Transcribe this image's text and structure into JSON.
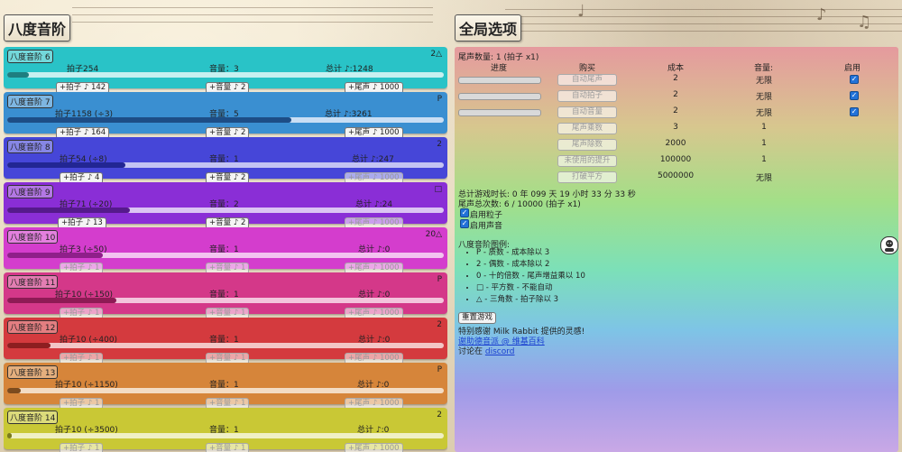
{
  "left_title": "八度音阶",
  "right_title": "全局选项",
  "panels": [
    {
      "tag": "八度音阶 6",
      "mark": "2△",
      "beats": "拍子254",
      "vol": "音量：3",
      "total": "总计 ♪:1248",
      "b1": "+拍子 ♪ 142",
      "b2": "+音量 ♪ 2",
      "b3": "+尾声 ♪ 1000",
      "progress": 0.05
    },
    {
      "tag": "八度音阶 7",
      "mark": "P",
      "beats": "拍子1158 (÷3)",
      "vol": "音量：5",
      "total": "总计 ♪:3261",
      "b1": "+拍子 ♪ 164",
      "b2": "+音量 ♪ 2",
      "b3": "+尾声 ♪ 1000",
      "progress": 0.65
    },
    {
      "tag": "八度音阶 8",
      "mark": "2",
      "beats": "拍子54 (÷8)",
      "vol": "音量：1",
      "total": "总计 ♪:247",
      "b1": "+拍子 ♪ 4",
      "b2": "+音量 ♪ 2",
      "b3": "+尾声 ♪ 1000",
      "progress": 0.27
    },
    {
      "tag": "八度音阶 9",
      "mark": "□",
      "beats": "拍子71 (÷20)",
      "vol": "音量：2",
      "total": "总计 ♪:24",
      "b1": "+拍子 ♪ 13",
      "b2": "+音量 ♪ 2",
      "b3": "+尾声 ♪ 1000",
      "progress": 0.28
    },
    {
      "tag": "八度音阶 10",
      "mark": "20△",
      "beats": "拍子3 (÷50)",
      "vol": "音量：1",
      "total": "总计 ♪:0",
      "b1": "+拍子 ♪ 1",
      "b2": "+音量 ♪ 1",
      "b3": "+尾声 ♪ 1000",
      "progress": 0.22
    },
    {
      "tag": "八度音阶 11",
      "mark": "P",
      "beats": "拍子10 (÷150)",
      "vol": "音量：1",
      "total": "总计 ♪:0",
      "b1": "+拍子 ♪ 1",
      "b2": "+音量 ♪ 1",
      "b3": "+尾声 ♪ 1000",
      "progress": 0.25
    },
    {
      "tag": "八度音阶 12",
      "mark": "2",
      "beats": "拍子10 (÷400)",
      "vol": "音量：1",
      "total": "总计 ♪:0",
      "b1": "+拍子 ♪ 1",
      "b2": "+音量 ♪ 1",
      "b3": "+尾声 ♪ 1000",
      "progress": 0.1
    },
    {
      "tag": "八度音阶 13",
      "mark": "P",
      "beats": "拍子10 (÷1150)",
      "vol": "音量：1",
      "total": "总计 ♪:0",
      "b1": "+拍子 ♪ 1",
      "b2": "+音量 ♪ 1",
      "b3": "+尾声 ♪ 1000",
      "progress": 0.03
    },
    {
      "tag": "八度音阶 14",
      "mark": "2",
      "beats": "拍子10 (÷3500)",
      "vol": "音量：1",
      "total": "总计 ♪:0",
      "b1": "+拍子 ♪ 1",
      "b2": "+音量 ♪ 1",
      "b3": "+尾声 ♪ 1000",
      "progress": 0.01
    }
  ],
  "colors": {
    "panel_bg": [
      "#29c3c7",
      "#3a8fd1",
      "#4646d8",
      "#8a2ed6",
      "#d43dcd",
      "#d43889",
      "#d43a3e",
      "#d6853a",
      "#c9c835"
    ],
    "panel_fill": [
      "#1e7e80",
      "#1d4d86",
      "#222693",
      "#551a8c",
      "#8f1f8a",
      "#8e1b55",
      "#8d1e20",
      "#7c4b1e",
      "#7a7a1c"
    ],
    "panel_track": [
      "#c8f0f0",
      "#c9def4",
      "#c4c4f3",
      "#dbc4f3",
      "#f3c4f0",
      "#f3c4dc",
      "#f3c6c6",
      "#f3dcc4",
      "#f0f0c4"
    ]
  },
  "right": {
    "echo_count": "尾声数量:  1  (拍子 x1)",
    "headers": [
      "进度",
      "购买",
      "成本",
      "音量:",
      "启用"
    ],
    "rows": [
      {
        "label": "自动尾声",
        "cost": "2",
        "vol": "无限",
        "checked": true,
        "has_progress": true
      },
      {
        "label": "自动拍子",
        "cost": "2",
        "vol": "无限",
        "checked": true,
        "has_progress": true
      },
      {
        "label": "自动音量",
        "cost": "2",
        "vol": "无限",
        "checked": true,
        "has_progress": true
      },
      {
        "label": "尾声乘数",
        "cost": "3",
        "vol": "1",
        "checked": false,
        "has_progress": false
      },
      {
        "label": "尾声除数",
        "cost": "2000",
        "vol": "1",
        "checked": false,
        "has_progress": false
      },
      {
        "label": "未使用的提升",
        "cost": "100000",
        "vol": "1",
        "checked": false,
        "has_progress": false
      },
      {
        "label": "打破平方",
        "cost": "5000000",
        "vol": "无限",
        "checked": false,
        "has_progress": false
      }
    ],
    "total_time": "总计游戏时长:   0 年 099 天 19 小时 33 分 33 秒",
    "total_echo": "尾声总次数:   6 / 10000  (拍子 x1)",
    "enable_particles": "启用粒子",
    "enable_sound": "启用声音",
    "legend_title": "八度音阶图例:",
    "legend": [
      "P - 质数 - 成本除以 3",
      "2 - 偶数 - 成本除以 2",
      "0 - 十的倍数 - 尾声增益乘以 10",
      "□ - 平方数 - 不能自动",
      "△ - 三角数 - 拍子除以 3"
    ],
    "reset": "重置游戏",
    "thanks": "特别感谢 Milk Rabbit 提供的灵感!",
    "link1": "谢助德音派 @ 维基百科",
    "discuss_prefix": "讨论在 ",
    "discord": "discord"
  }
}
